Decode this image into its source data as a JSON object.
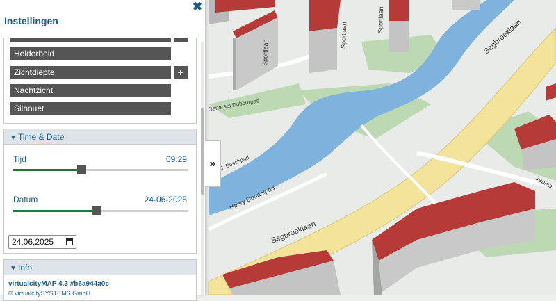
{
  "panel": {
    "title": "Instellingen",
    "close_glyph": "✖",
    "style_items": [
      {
        "label": "Helderheid"
      },
      {
        "label": "Zichtdiepte"
      },
      {
        "label": "Nachtzicht"
      },
      {
        "label": "Silhouet"
      }
    ],
    "plus_glyph": "+",
    "time_date": {
      "title": "Time & Date",
      "time_label": "Tijd",
      "time_value": "09:29",
      "time_fraction": 0.39,
      "date_label": "Datum",
      "date_value": "24-06-2025",
      "date_fraction": 0.475,
      "date_input": "24,06,2025"
    },
    "info": {
      "title": "Info",
      "version": "virtualcityMAP 4.3 #b6a944a0c",
      "copyright": "© virtualcitySYSTEMS GmbH"
    }
  },
  "toggle": {
    "glyph": "»"
  },
  "map": {
    "streets": [
      {
        "label": "Segbroeklaan"
      },
      {
        "label": "Segbroeklaan"
      },
      {
        "label": "Henry Dunantpad"
      },
      {
        "label": "Sportlaan"
      },
      {
        "label": "Sportlaan"
      },
      {
        "label": "Sportlaan"
      },
      {
        "label": "Generaal Dubourpad"
      },
      {
        "label": "J. Boschpad"
      },
      {
        "label": "Jeplaa"
      }
    ]
  },
  "colors": {
    "accent": "#1a5e8f",
    "slider_fill": "#1f7a3a",
    "item_bg": "#555555"
  }
}
